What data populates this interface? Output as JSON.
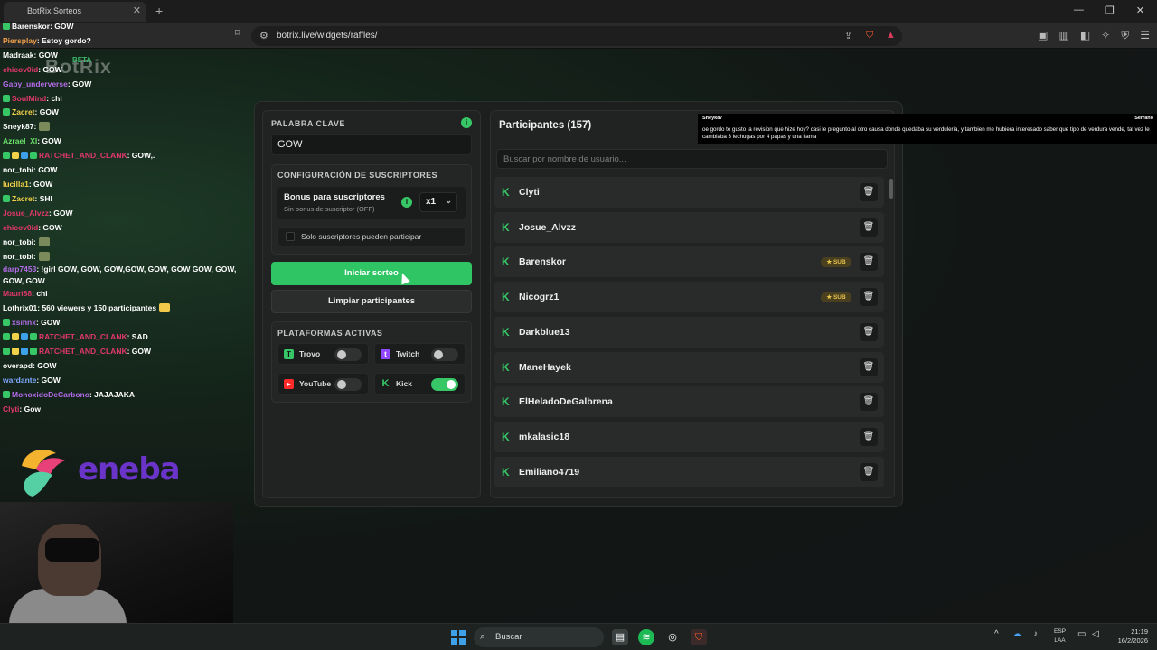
{
  "browser": {
    "tab_title": "BotRix Sorteos",
    "tab_overlay_text": "GOW",
    "url": "botrix.live/widgets/raffles/",
    "new_tab": "+",
    "close": "✕"
  },
  "chat": [
    {
      "user": "Barenskor",
      "msg": ": GOW",
      "color": "#ffffff",
      "badge": "#37c767"
    },
    {
      "user": "Piersplay",
      "msg": ": Estoy gordo?",
      "color": "#f0a24a"
    },
    {
      "user": "Madraak",
      "msg": ": GOW",
      "color": "#ffffff"
    },
    {
      "user": "chicov0id",
      "msg": ": GOW",
      "color": "#e0386a"
    },
    {
      "user": "Gaby_underverse",
      "msg": ": GOW",
      "color": "#b26ce8"
    },
    {
      "user": "SoulMind",
      "msg": ": chi",
      "color": "#e0386a",
      "badge": "#37c767"
    },
    {
      "user": "Zacret",
      "msg": ": GOW",
      "color": "#f2d14a",
      "badge": "#37c767"
    },
    {
      "user": "Sneyk87",
      "msg": ":",
      "color": "#ffffff",
      "emote": true
    },
    {
      "user": "Azrael_XI",
      "msg": ": GOW",
      "color": "#6be26b"
    },
    {
      "user": "RATCHET_AND_CLANK",
      "msg": ": GOW,.",
      "color": "#e0386a",
      "badge": "#37c767",
      "multi": true
    },
    {
      "user": "nor_tobi",
      "msg": ": GOW",
      "color": "#ffffff"
    },
    {
      "user": "lucilla1",
      "msg": ": GOW",
      "color": "#f2d14a"
    },
    {
      "user": "Zacret",
      "msg": ": SHI",
      "color": "#f2d14a",
      "badge": "#37c767"
    },
    {
      "user": "Josue_Alvzz",
      "msg": ": GOW",
      "color": "#e0386a"
    },
    {
      "user": "chicov0id",
      "msg": ": GOW",
      "color": "#e0386a"
    },
    {
      "user": "nor_tobi",
      "msg": ":",
      "color": "#ffffff",
      "emote": true
    },
    {
      "user": "nor_tobi",
      "msg": ":",
      "color": "#ffffff",
      "emote": true
    },
    {
      "user": "darp7453",
      "msg": ": !girl GOW, GOW, GOW,GOW, GOW, GOW GOW, GOW, GOW, GOW",
      "color": "#b26ce8",
      "wrap": true
    },
    {
      "user": "Mauri88",
      "msg": ": chi",
      "color": "#e0386a"
    },
    {
      "user": "Lothrix01",
      "msg": ": 560 viewers y 150 participantes",
      "color": "#ffffff",
      "emote": true
    },
    {
      "user": "xsihnx",
      "msg": ": GOW",
      "color": "#b26ce8",
      "badge": "#37c767"
    },
    {
      "user": "RATCHET_AND_CLANK",
      "msg": ": SAD",
      "color": "#e0386a",
      "badge": "#37c767",
      "multi": true
    },
    {
      "user": "RATCHET_AND_CLANK",
      "msg": ": GOW",
      "color": "#e0386a",
      "badge": "#37c767",
      "multi": true
    },
    {
      "user": "overapd",
      "msg": ": GOW",
      "color": "#ffffff"
    },
    {
      "user": "wardante",
      "msg": ": GOW",
      "color": "#7fa9ff"
    },
    {
      "user": "MonoxidoDeCarbono",
      "msg": ": JAJAJAKA",
      "color": "#b26ce8",
      "badge": "#37c767"
    },
    {
      "user": "Clyti",
      "msg": ": Gow",
      "color": "#e0386a"
    }
  ],
  "overlay": {
    "botrix_logo": "BotRix",
    "beta": "BETA",
    "sponsor": "eneba"
  },
  "raffle": {
    "keyword_label": "PALABRA CLAVE",
    "keyword_value": "GOW",
    "sub_config_title": "CONFIGURACIÓN DE SUSCRIPTORES",
    "bonus_title": "Bonus para suscriptores",
    "bonus_sub": "Sin bonus de suscriptor (OFF)",
    "multiplier": "x1",
    "only_subs_label": "Solo suscriptores pueden participar",
    "start_button": "Iniciar sorteo",
    "clear_button": "Limpiar participantes",
    "platforms_title": "PLATAFORMAS ACTIVAS",
    "platforms": [
      {
        "name": "Trovo",
        "enabled": false,
        "color": "#37c767"
      },
      {
        "name": "Twitch",
        "enabled": false,
        "color": "#9146ff"
      },
      {
        "name": "YouTube",
        "enabled": false,
        "color": "#ff2a2a"
      },
      {
        "name": "Kick",
        "enabled": true,
        "color": "#37c767"
      }
    ]
  },
  "participants": {
    "title": "Participantes (157)",
    "search_placeholder": "Buscar por nombre de usuario...",
    "sub_label": "SUB",
    "list": [
      {
        "name": "Clyti",
        "sub": false
      },
      {
        "name": "Josue_Alvzz",
        "sub": false
      },
      {
        "name": "Barenskor",
        "sub": true
      },
      {
        "name": "Nicogrz1",
        "sub": true
      },
      {
        "name": "Darkblue13",
        "sub": false
      },
      {
        "name": "ManeHayek",
        "sub": false
      },
      {
        "name": "ElHeladoDeGalbrena",
        "sub": false
      },
      {
        "name": "mkalasic18",
        "sub": false
      },
      {
        "name": "Emiliano4719",
        "sub": false
      }
    ]
  },
  "notification": {
    "user": "Sneyk87",
    "right": "Serrano",
    "message": "oe gordo te gusto la revision que hize hoy? casi le pregunto al otro causa donde quedaba su verduleria, y tambien me hubiera interesado saber que tipo de verdura vende, tal vez le cambiaba 3 lechugas por 4 papas y una llama"
  },
  "taskbar": {
    "search": "Buscar",
    "lang_top": "ESP",
    "lang_bottom": "LAA",
    "time": "21:19",
    "date": "16/2/2026"
  }
}
